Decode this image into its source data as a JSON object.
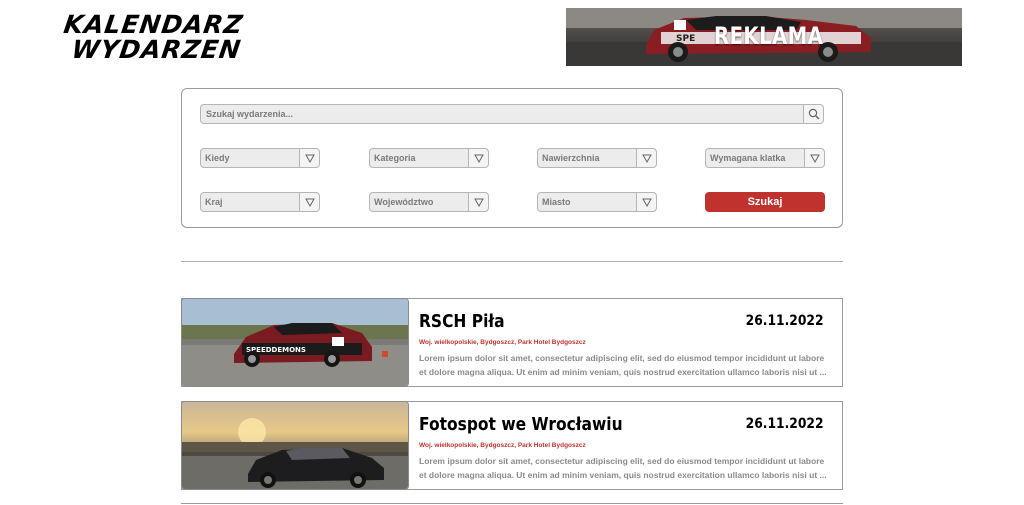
{
  "logo": {
    "line1": "KALENDARZ",
    "line2": "WYDARZEN"
  },
  "ad": {
    "label": "REKLAMA"
  },
  "search": {
    "placeholder": "Szukaj wydarzenia...",
    "filters_row1": [
      "Kiedy",
      "Kategoria",
      "Nawierzchnia",
      "Wymagana klatka"
    ],
    "filters_row2": [
      "Kraj",
      "Województwo",
      "Miasto"
    ],
    "submit_label": "Szukaj"
  },
  "events": [
    {
      "title": "RSCH Piła",
      "date": "26.11.2022",
      "location": "Woj. wielkopolskie, Bydgoszcz, Park Hotel Bydgoszcz",
      "description": "Lorem ipsum dolor sit amet, consectetur adipiscing elit, sed do eiusmod tempor incididunt ut labore et dolore magna aliqua. Ut enim ad minim veniam, quis nostrud exercitation ullamco laboris nisi ut ..."
    },
    {
      "title": "Fotospot we Wrocławiu",
      "date": "26.11.2022",
      "location": "Woj. wielkopolskie, Bydgoszcz, Park Hotel Bydgoszcz",
      "description": "Lorem ipsum dolor sit amet, consectetur adipiscing elit, sed do eiusmod tempor incididunt ut labore et dolore magna aliqua. Ut enim ad minim veniam, quis nostrud exercitation ullamco laboris nisi ut ..."
    }
  ],
  "colors": {
    "accent": "#c0322d",
    "border": "#9a9a9a",
    "field_bg": "#ececec"
  }
}
